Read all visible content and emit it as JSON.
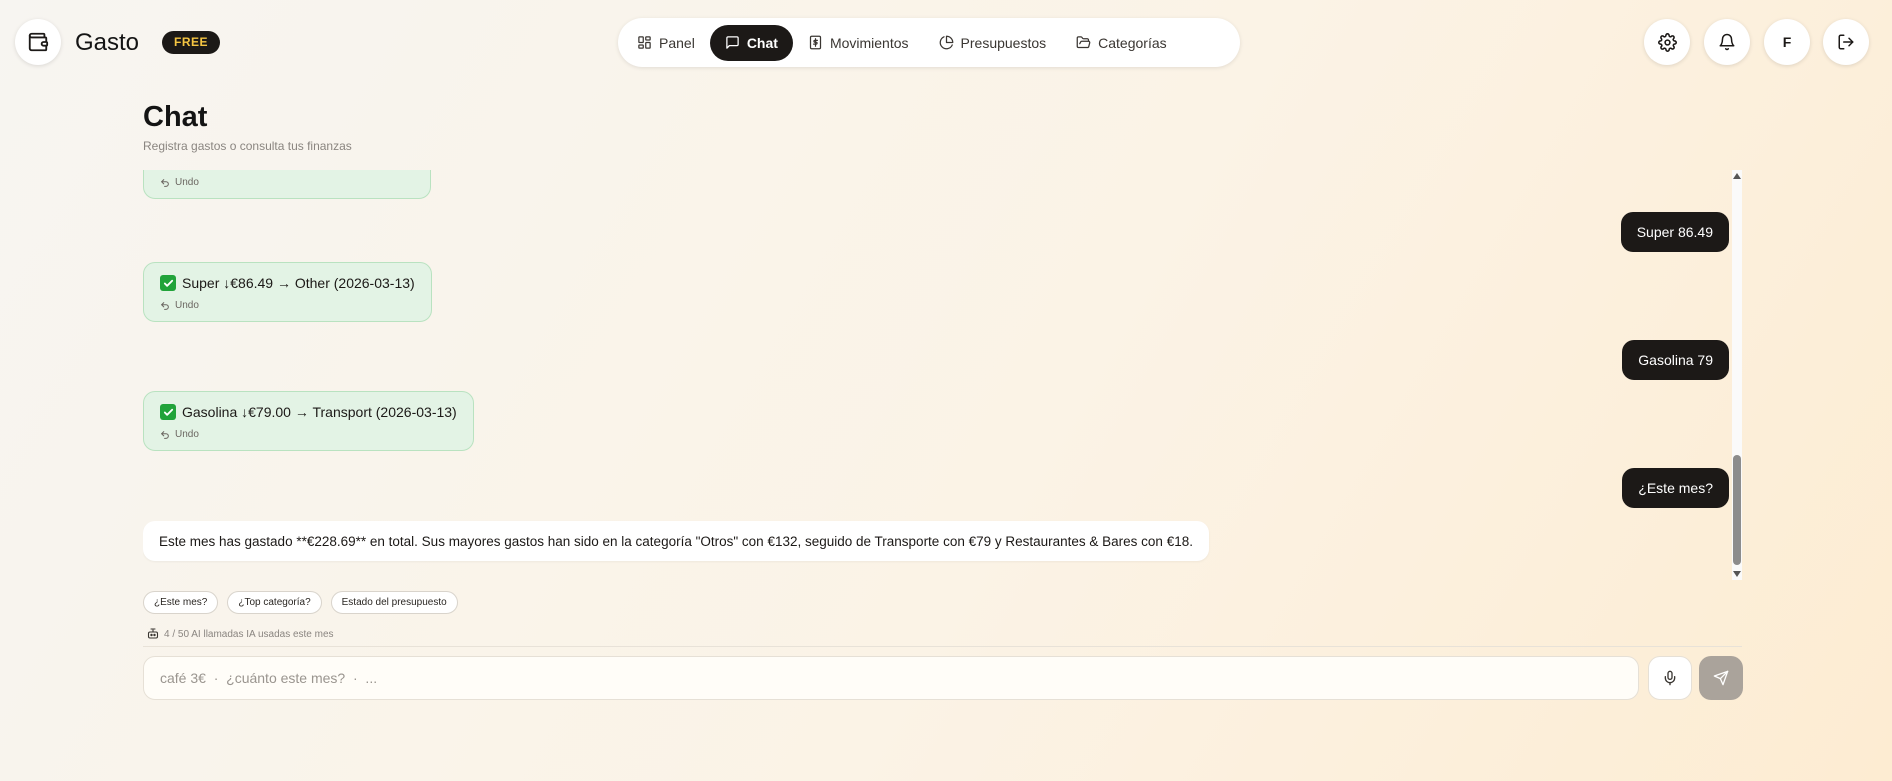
{
  "app": {
    "name": "Gasto",
    "plan_badge": "FREE"
  },
  "nav": {
    "items": [
      {
        "label": "Panel",
        "icon": "layout-grid-icon",
        "active": false
      },
      {
        "label": "Chat",
        "icon": "message-square-icon",
        "active": true
      },
      {
        "label": "Movimientos",
        "icon": "receipt-icon",
        "active": false
      },
      {
        "label": "Presupuestos",
        "icon": "pie-chart-icon",
        "active": false
      },
      {
        "label": "Categorías",
        "icon": "folder-icon",
        "active": false
      }
    ]
  },
  "header_actions": {
    "settings_icon": "gear-icon",
    "notifications_icon": "bell-icon",
    "avatar_initial": "F",
    "logout_icon": "logout-icon"
  },
  "page": {
    "title": "Chat",
    "subtitle": "Registra gastos o consulta tus finanzas"
  },
  "messages": [
    {
      "role": "bot",
      "status": "ok",
      "text": "",
      "undo_label": "Undo"
    },
    {
      "role": "user",
      "text": "Super 86.49"
    },
    {
      "role": "bot",
      "status": "ok",
      "text": "Super ↓€86.49 → Other (2026-03-13)",
      "undo_label": "Undo"
    },
    {
      "role": "user",
      "text": "Gasolina 79"
    },
    {
      "role": "bot",
      "status": "ok",
      "text": "Gasolina ↓€79.00 → Transport (2026-03-13)",
      "undo_label": "Undo"
    },
    {
      "role": "user",
      "text": "¿Este mes?"
    },
    {
      "role": "bot",
      "text": "Este mes has gastado **€228.69** en total. Sus mayores gastos han sido en la categoría \"Otros\" con €132, seguido de Transporte con €79 y Restaurantes & Bares con €18."
    }
  ],
  "suggestions": [
    "¿Este mes?",
    "¿Top categoría?",
    "Estado del presupuesto"
  ],
  "ai_usage": {
    "text": "4 / 50 AI llamadas IA usadas este mes"
  },
  "composer": {
    "placeholder": "café 3€  ·  ¿cuánto este mes?  ·  ...",
    "value": ""
  },
  "colors": {
    "primary": "#1c1917",
    "badge_text": "#f5c542",
    "success_bg": "#e3f3e5",
    "success_check": "#21a33a",
    "send_button": "#aaa39b"
  }
}
